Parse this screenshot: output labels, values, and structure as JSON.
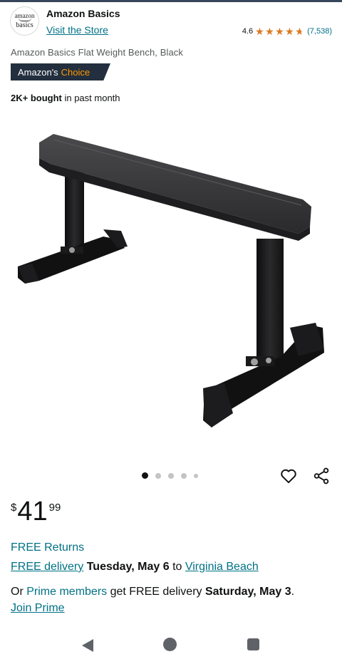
{
  "brand": {
    "logo_line1": "amazon",
    "logo_line2": "basics",
    "name": "Amazon Basics",
    "visit_store": "Visit the Store"
  },
  "rating": {
    "value": "4.6",
    "stars": 4.6,
    "count": "(7,538)",
    "star_color": "#de7921"
  },
  "product": {
    "title": "Amazon Basics Flat Weight Bench, Black",
    "badge_part1": "Amazon's",
    "badge_part2": "Choice",
    "bought_bold": "2K+ bought",
    "bought_rest": " in past month",
    "image_icon": "weight-bench-photo"
  },
  "carousel": {
    "dot_count": 5,
    "active_index": 0
  },
  "actions": {
    "favorite_icon": "heart-icon",
    "share_icon": "share-icon"
  },
  "price": {
    "symbol": "$",
    "whole": "41",
    "fraction": "99"
  },
  "delivery": {
    "free_returns": "FREE Returns",
    "free_delivery": "FREE delivery",
    "date": "Tuesday, May 6",
    "to": "to",
    "location": "Virginia Beach",
    "or": "Or",
    "prime_members": "Prime members",
    "prime_mid": "get FREE delivery",
    "prime_date": "Saturday, May 3",
    "period": ".",
    "join_prime": "Join Prime"
  },
  "colors": {
    "link": "#007185",
    "badge_bg": "#232f3e",
    "badge_accent": "#ff9900"
  },
  "nav": {
    "back_icon": "back-triangle-icon",
    "home_icon": "home-circle-icon",
    "recent_icon": "recents-square-icon"
  }
}
